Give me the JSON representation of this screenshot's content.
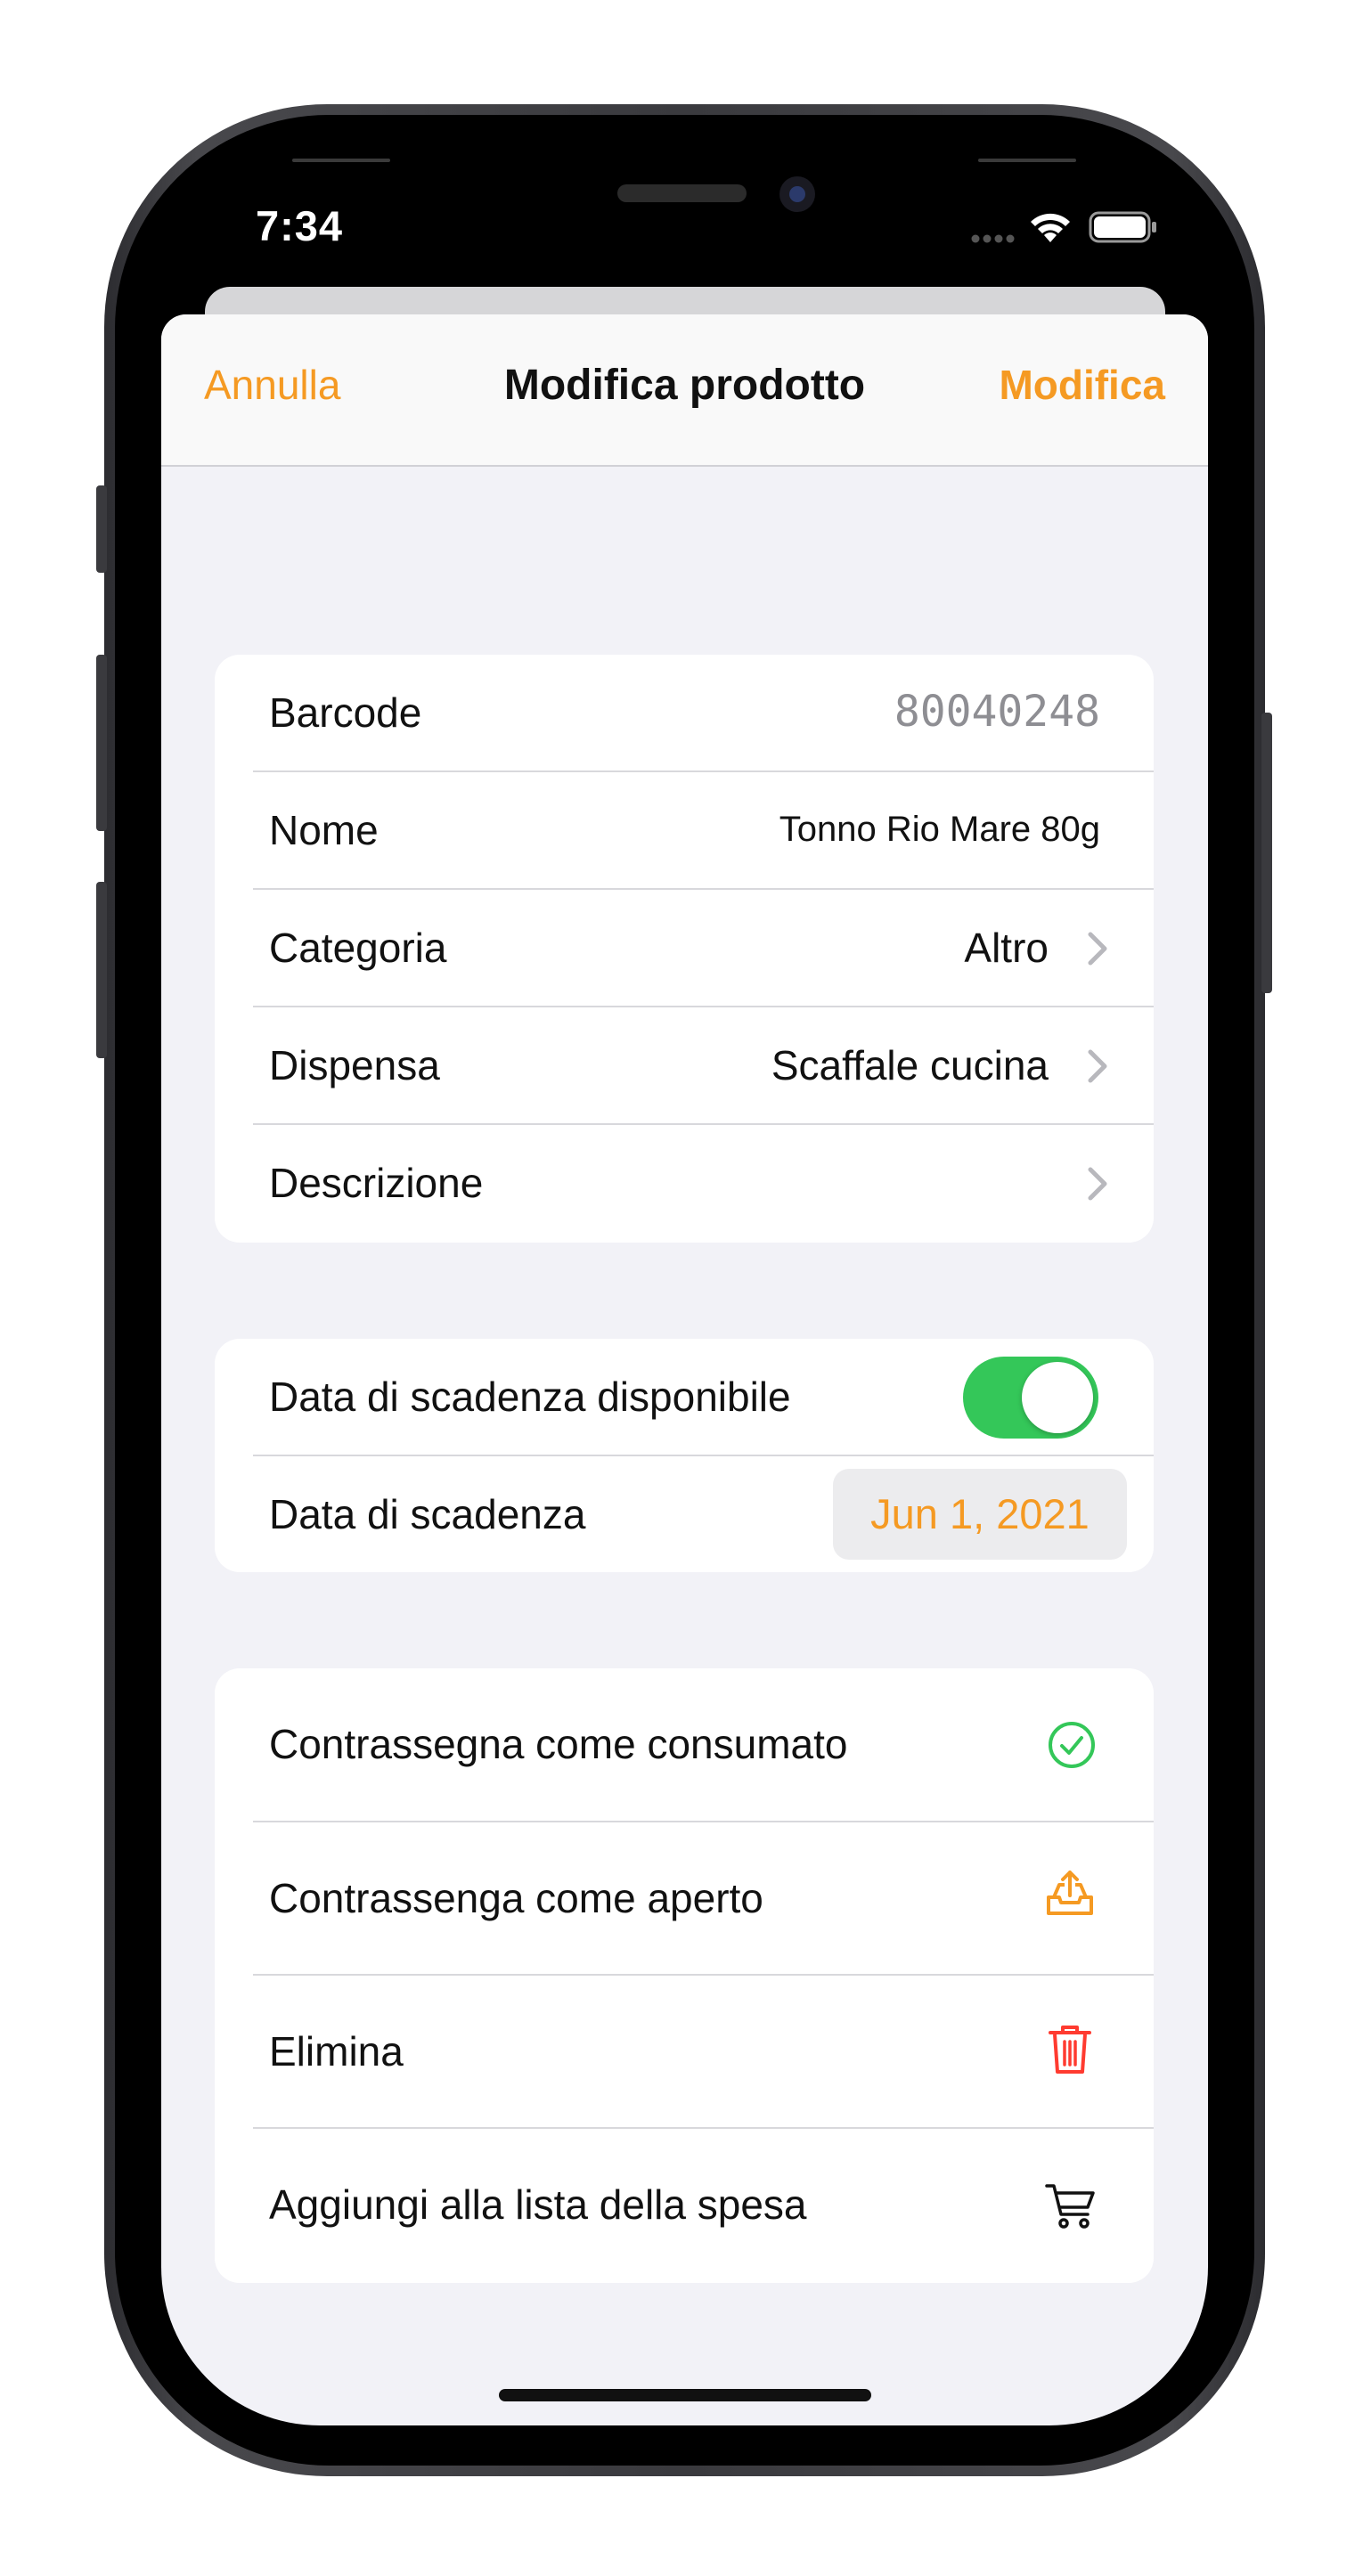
{
  "status_bar": {
    "time": "7:34"
  },
  "navbar": {
    "left_label": "Annulla",
    "title": "Modifica prodotto",
    "right_label": "Modifica"
  },
  "details": {
    "barcode": {
      "label": "Barcode",
      "value": "80040248"
    },
    "nome": {
      "label": "Nome",
      "value": "Tonno Rio Mare 80g"
    },
    "categoria": {
      "label": "Categoria",
      "value": "Altro"
    },
    "dispensa": {
      "label": "Dispensa",
      "value": "Scaffale cucina"
    },
    "descrizione": {
      "label": "Descrizione",
      "value": ""
    }
  },
  "expiry": {
    "available_label": "Data di scadenza disponibile",
    "available_on": true,
    "date_label": "Data di scadenza",
    "date_value": "Jun 1, 2021"
  },
  "actions": [
    {
      "label": "Contrassegna come consumato",
      "icon": "checkmark-circle-icon",
      "color": "#34c759"
    },
    {
      "label": "Contrassenga come aperto",
      "icon": "tray-upload-icon",
      "color": "#f59a23"
    },
    {
      "label": "Elimina",
      "icon": "trash-icon",
      "color": "#ff3b30"
    },
    {
      "label": "Aggiungi alla lista della spesa",
      "icon": "cart-icon",
      "color": "#111111"
    }
  ],
  "colors": {
    "accent": "#f59a23",
    "toggle_on": "#34c759",
    "background": "#f2f2f7"
  }
}
